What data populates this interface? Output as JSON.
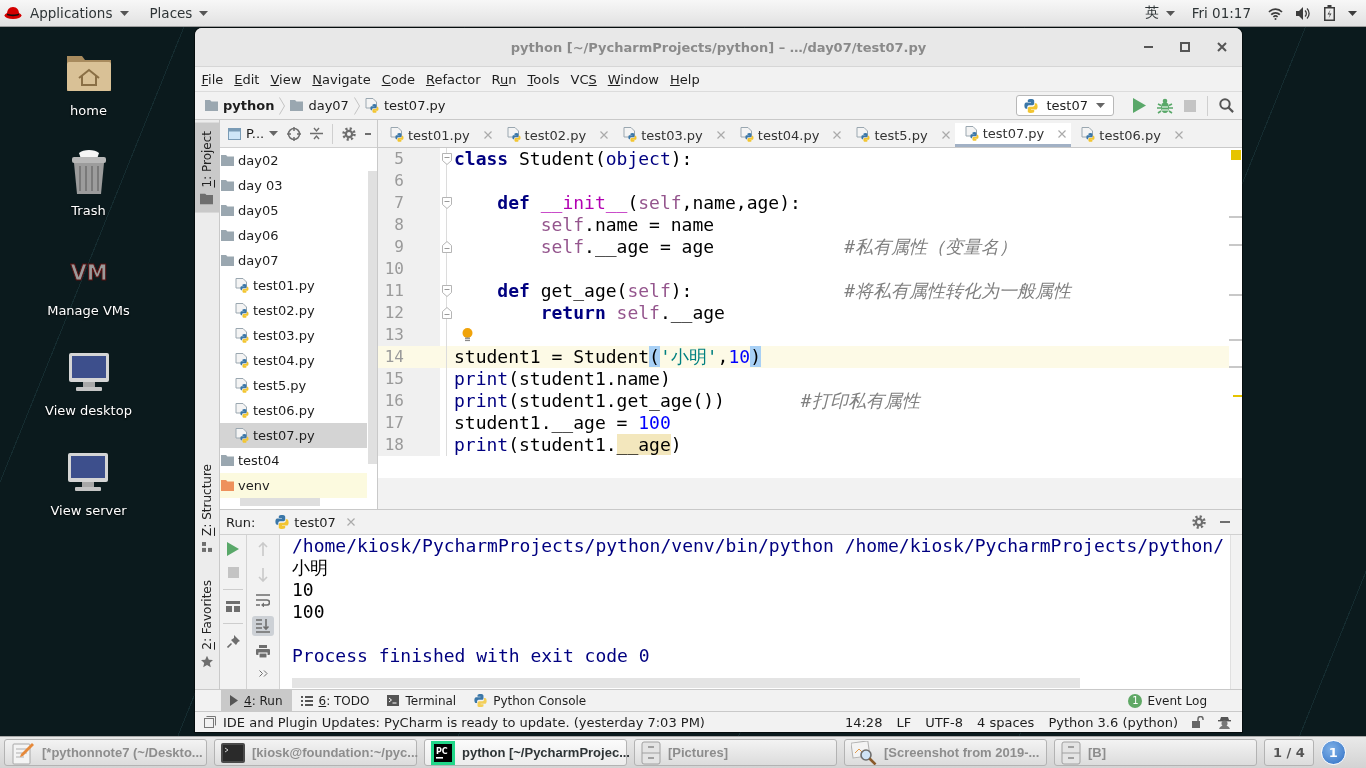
{
  "top_bar": {
    "applications": "Applications",
    "places": "Places",
    "input_method": "英",
    "clock": "Fri 01:17"
  },
  "desktop_icons": [
    {
      "label": "home",
      "kind": "home"
    },
    {
      "label": "Trash",
      "kind": "trash"
    },
    {
      "label": "Manage VMs",
      "kind": "vm",
      "icon_text": "VM"
    },
    {
      "label": "View desktop",
      "kind": "monitor"
    },
    {
      "label": "View server",
      "kind": "monitor"
    }
  ],
  "window": {
    "title": "python [~/PycharmProjects/python] – …/day07/test07.py"
  },
  "menu": [
    {
      "key": "F",
      "after": "ile"
    },
    {
      "key": "E",
      "after": "dit"
    },
    {
      "key": "V",
      "after": "iew"
    },
    {
      "key": "N",
      "after": "avigate"
    },
    {
      "key": "C",
      "after": "ode"
    },
    {
      "key": "R",
      "after": "efactor"
    },
    {
      "before": "R",
      "key": "u",
      "after": "n"
    },
    {
      "key": "T",
      "after": "ools"
    },
    {
      "before": "VC",
      "key": "S"
    },
    {
      "key": "W",
      "after": "indow"
    },
    {
      "key": "H",
      "after": "elp"
    }
  ],
  "navigation": {
    "breadcrumbs": [
      {
        "label": "python",
        "kind": "project"
      },
      {
        "label": "day07",
        "kind": "folder"
      },
      {
        "label": "test07.py",
        "kind": "file"
      }
    ],
    "run_config": "test07",
    "actions": [
      {
        "kind": "run",
        "disabled": false
      },
      {
        "kind": "debug",
        "disabled": false
      },
      {
        "kind": "stop",
        "disabled": true
      },
      {
        "kind": "search",
        "disabled": false
      }
    ]
  },
  "tool_windows_left": [
    {
      "key": "1",
      "after": ": Project",
      "kind": "project",
      "selected": true
    },
    {
      "key": "Z",
      "after": ": Structure",
      "kind": "structure",
      "selected": false
    },
    {
      "key": "2",
      "after": ": Favorites",
      "kind": "favorites",
      "selected": false
    }
  ],
  "project": {
    "view": "P...",
    "tree": [
      {
        "label": "day02",
        "kind": "folder",
        "selected": false
      },
      {
        "label": "day 03",
        "kind": "folder",
        "selected": false
      },
      {
        "label": "day05",
        "kind": "folder",
        "selected": false
      },
      {
        "label": "day06",
        "kind": "folder",
        "selected": false
      },
      {
        "label": "day07",
        "kind": "folder",
        "selected": false,
        "children": [
          {
            "label": "test01.py",
            "kind": "python_file",
            "selected": false
          },
          {
            "label": "test02.py",
            "kind": "python_file",
            "selected": false
          },
          {
            "label": "test03.py",
            "kind": "python_file",
            "selected": false
          },
          {
            "label": "test04.py",
            "kind": "python_file",
            "selected": false
          },
          {
            "label": "test5.py",
            "kind": "python_file",
            "selected": false
          },
          {
            "label": "test06.py",
            "kind": "python_file",
            "selected": false
          },
          {
            "label": "test07.py",
            "kind": "python_file",
            "selected": true
          }
        ]
      },
      {
        "label": "test04",
        "kind": "folder",
        "selected": false
      },
      {
        "label": "venv",
        "kind": "excluded_folder",
        "selected": false
      }
    ]
  },
  "editor": {
    "tabs": [
      {
        "label": "test01.py",
        "selected": false
      },
      {
        "label": "test02.py",
        "selected": false
      },
      {
        "label": "test03.py",
        "selected": false
      },
      {
        "label": "test04.py",
        "selected": false
      },
      {
        "label": "test5.py",
        "selected": false
      },
      {
        "label": "test07.py",
        "selected": true
      },
      {
        "label": "test06.py",
        "selected": false
      }
    ],
    "lines": [
      {
        "number": "5",
        "current": false,
        "bulb": false,
        "fold_start": true,
        "fold_end": false,
        "tokens": [
          {
            "kind": "keyword",
            "text": "class"
          },
          {
            "kind": "plain",
            "text": " Student("
          },
          {
            "kind": "builtin",
            "text": "object"
          },
          {
            "kind": "plain",
            "text": "):"
          }
        ]
      },
      {
        "number": "6",
        "current": false,
        "bulb": false,
        "fold_start": false,
        "fold_end": false
      },
      {
        "number": "7",
        "current": false,
        "bulb": false,
        "fold_start": true,
        "fold_end": false,
        "tokens": [
          {
            "kind": "keyword",
            "text": "    def "
          },
          {
            "kind": "magic",
            "text": "__init__"
          },
          {
            "kind": "plain",
            "text": "("
          },
          {
            "kind": "self",
            "text": "self"
          },
          {
            "kind": "plain",
            "text": ",name,age):"
          }
        ]
      },
      {
        "number": "8",
        "current": false,
        "bulb": false,
        "fold_start": false,
        "fold_end": false,
        "tokens": [
          {
            "kind": "self",
            "text": "        self"
          },
          {
            "kind": "plain",
            "text": ".name = name"
          }
        ]
      },
      {
        "number": "9",
        "current": false,
        "bulb": false,
        "fold_start": false,
        "fold_end": true,
        "tokens": [
          {
            "kind": "self",
            "text": "        self"
          },
          {
            "kind": "plain",
            "text": ".__age = age            "
          },
          {
            "kind": "comment",
            "text": "#私有属性（变量名）"
          }
        ]
      },
      {
        "number": "10",
        "current": false,
        "bulb": false,
        "fold_start": false,
        "fold_end": false
      },
      {
        "number": "11",
        "current": false,
        "bulb": false,
        "fold_start": true,
        "fold_end": false,
        "tokens": [
          {
            "kind": "keyword",
            "text": "    def"
          },
          {
            "kind": "plain",
            "text": " get_age("
          },
          {
            "kind": "self",
            "text": "self"
          },
          {
            "kind": "plain",
            "text": "):              "
          },
          {
            "kind": "comment",
            "text": "#将私有属性转化为一般属性"
          }
        ]
      },
      {
        "number": "12",
        "current": false,
        "bulb": false,
        "fold_start": false,
        "fold_end": true,
        "tokens": [
          {
            "kind": "keyword",
            "text": "        return "
          },
          {
            "kind": "self",
            "text": "self"
          },
          {
            "kind": "plain",
            "text": ".__age"
          }
        ]
      },
      {
        "number": "13",
        "current": false,
        "bulb": true,
        "fold_start": false,
        "fold_end": false
      },
      {
        "number": "14",
        "current": true,
        "bulb": false,
        "fold_start": false,
        "fold_end": false,
        "tokens": [
          {
            "kind": "plain",
            "text": "student1 = Student"
          },
          {
            "kind": "matched_brace",
            "text": "("
          },
          {
            "kind": "string",
            "text": "'小明'"
          },
          {
            "kind": "plain",
            "text": ","
          },
          {
            "kind": "number",
            "text": "10"
          },
          {
            "kind": "matched_brace",
            "text": ")"
          }
        ]
      },
      {
        "number": "15",
        "current": false,
        "bulb": false,
        "fold_start": false,
        "fold_end": false,
        "tokens": [
          {
            "kind": "builtin",
            "text": "print"
          },
          {
            "kind": "plain",
            "text": "(student1.name)"
          }
        ]
      },
      {
        "number": "16",
        "current": false,
        "bulb": false,
        "fold_start": false,
        "fold_end": false,
        "tokens": [
          {
            "kind": "builtin",
            "text": "print"
          },
          {
            "kind": "plain",
            "text": "(student1.get_age())       "
          },
          {
            "kind": "comment",
            "text": "#打印私有属性"
          }
        ]
      },
      {
        "number": "17",
        "current": false,
        "bulb": false,
        "fold_start": false,
        "fold_end": false,
        "tokens": [
          {
            "kind": "plain",
            "text": "student1.__age = "
          },
          {
            "kind": "number",
            "text": "100"
          }
        ]
      },
      {
        "number": "18",
        "current": false,
        "bulb": false,
        "fold_start": false,
        "fold_end": false,
        "tokens": [
          {
            "kind": "builtin",
            "text": "print"
          },
          {
            "kind": "plain",
            "text": "(student1."
          },
          {
            "kind": "warning",
            "text": "__age"
          },
          {
            "kind": "plain",
            "text": ")"
          }
        ]
      }
    ]
  },
  "run": {
    "title": "Run:",
    "tab": "test07",
    "toolbar": [
      {
        "kind": "rerun",
        "disabled": false
      },
      {
        "kind": "stop",
        "disabled": true
      },
      {
        "kind": "layout",
        "disabled": false
      },
      {
        "kind": "pin",
        "disabled": false
      }
    ],
    "toolbar_2": [
      {
        "kind": "up",
        "disabled": true,
        "on": false
      },
      {
        "kind": "down",
        "disabled": true,
        "on": false
      },
      {
        "kind": "wrap",
        "disabled": false,
        "on": false
      },
      {
        "kind": "scroll_end",
        "disabled": false,
        "on": true
      },
      {
        "kind": "print",
        "disabled": false,
        "on": false
      },
      {
        "kind": "more",
        "disabled": false,
        "on": false
      }
    ],
    "console": [
      {
        "kind": "command",
        "text": "/home/kiosk/PycharmProjects/python/venv/bin/python /home/kiosk/PycharmProjects/python/"
      },
      {
        "kind": "output",
        "text": "小明"
      },
      {
        "kind": "output",
        "text": "10"
      },
      {
        "kind": "output",
        "text": "100"
      },
      {
        "kind": "exit",
        "text": "Process finished with exit code 0"
      }
    ]
  },
  "bottom_tools": [
    {
      "key": "4",
      "after": ": Run",
      "kind": "run",
      "selected": true
    },
    {
      "key": "6",
      "after": ": TODO",
      "kind": "todo",
      "selected": false
    },
    {
      "label": "Terminal",
      "kind": "terminal",
      "selected": false
    },
    {
      "label": "Python Console",
      "kind": "console",
      "selected": false
    }
  ],
  "event_log": {
    "label": "Event Log",
    "count": "1"
  },
  "status_bar": {
    "message": "IDE and Plugin Updates: PyCharm is ready to update. (yesterday 7:03 PM)",
    "items": [
      "14:28",
      "LF",
      "UTF-8",
      "4 spaces",
      "Python 3.6 (python)"
    ]
  },
  "taskbar": {
    "items": [
      {
        "label": "[*pythonnote7 (~/Deskto...",
        "kind": "text_editor",
        "selected": false
      },
      {
        "label": "[kiosk@foundation:~/pyc...",
        "kind": "terminal",
        "selected": false
      },
      {
        "label": "python [~/PycharmProjec...",
        "kind": "ide",
        "icon_text": "PC",
        "selected": true
      },
      {
        "label": "[Pictures]",
        "kind": "files",
        "selected": false
      },
      {
        "label": "[Screenshot from 2019-...",
        "kind": "image_viewer",
        "selected": false
      },
      {
        "label": "[B]",
        "kind": "files",
        "selected": false
      }
    ],
    "workspace": "1 / 4",
    "notifications": "1"
  }
}
